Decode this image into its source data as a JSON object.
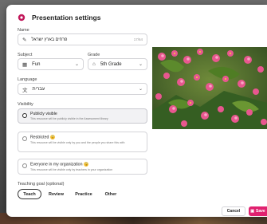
{
  "header": {
    "title": "Presentation settings"
  },
  "name": {
    "label": "Name",
    "value": "פרחים בארץ ישראל",
    "count": "17/64"
  },
  "subject": {
    "label": "Subject",
    "value": "Fun"
  },
  "grade": {
    "label": "Grade",
    "value": "5th Grade"
  },
  "language": {
    "label": "Language",
    "value": "עברית"
  },
  "visibility": {
    "label": "Visibility",
    "options": [
      {
        "title": "Publicly visible",
        "desc": "This resource will be publicly visible in the Assessment library"
      },
      {
        "title": "Restricted",
        "desc": "This resource will be visible only by you and the people you share this with"
      },
      {
        "title": "Everyone in my organization",
        "desc": "This resource will be visible only by teachers in your organization"
      }
    ]
  },
  "teaching_goal": {
    "label": "Teaching goal (optional)",
    "chips": [
      "Teach",
      "Review",
      "Practice",
      "Other"
    ]
  },
  "footer": {
    "cancel": "Cancel",
    "save": "Save"
  },
  "colors": {
    "accent": "#e0206f",
    "brand": "#c2185b"
  },
  "icons": {
    "header": "settings-cog-icon",
    "name": "pencil-icon",
    "subject": "calendar-icon",
    "grade": "graduation-cap-icon",
    "language": "translate-icon",
    "save": "save-icon"
  }
}
